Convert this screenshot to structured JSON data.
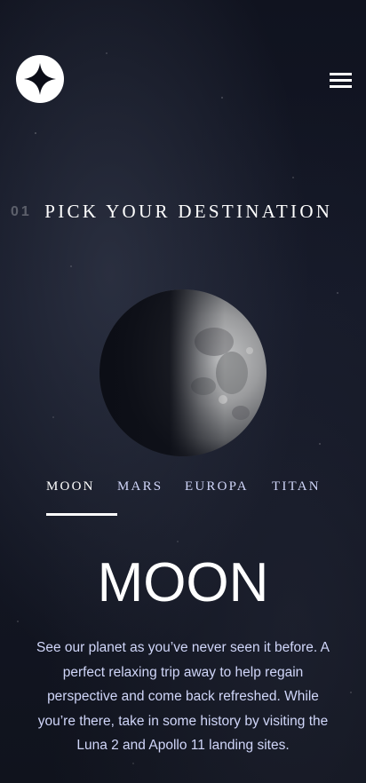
{
  "header": {
    "logo_icon": "star-logo-icon",
    "menu_icon": "hamburger-menu-icon"
  },
  "heading": {
    "number": "01",
    "title": "PICK YOUR DESTINATION"
  },
  "tabs": [
    {
      "label": "MOON",
      "active": true
    },
    {
      "label": "MARS",
      "active": false
    },
    {
      "label": "EUROPA",
      "active": false
    },
    {
      "label": "TITAN",
      "active": false
    }
  ],
  "destination": {
    "name": "MOON",
    "description": "See our planet as you’ve never seen it before. A perfect relaxing trip away to help regain perspective and come back refreshed. While you’re there, take in some history by visiting the Luna 2 and Apollo 11 landing sites."
  },
  "colors": {
    "background": "#0b0d17",
    "text_light": "#d0d6f9",
    "white": "#ffffff"
  }
}
